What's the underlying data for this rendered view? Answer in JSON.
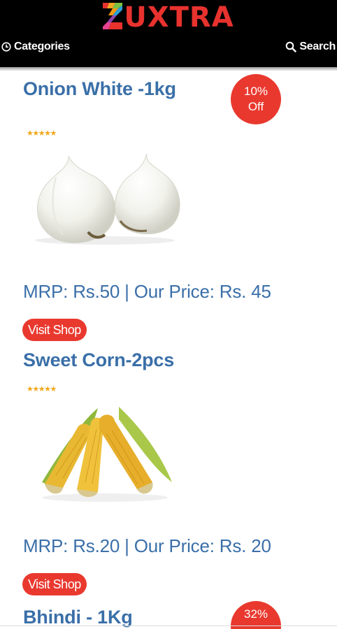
{
  "header": {
    "logo_text": "UXTRA",
    "categories_label": "Categories",
    "search_label": "Search"
  },
  "products": [
    {
      "title": "Onion White -1kg",
      "discount_value": "10%",
      "discount_suffix": "Off",
      "stars": "★★★★★",
      "price": "MRP: Rs.50 | Our Price: Rs. 45",
      "visit_label": "Visit Shop"
    },
    {
      "title": "Sweet Corn-2pcs",
      "stars": "★★★★★",
      "price": "MRP: Rs.20 | Our Price: Rs. 20",
      "visit_label": "Visit Shop"
    },
    {
      "title": "Bhindi - 1Kg",
      "discount_value": "32%"
    }
  ],
  "colors": {
    "header_bg": "#000000",
    "brand_red": "#e8322e",
    "title_blue": "#3a6fa8",
    "star_gold": "#f1a81c"
  }
}
